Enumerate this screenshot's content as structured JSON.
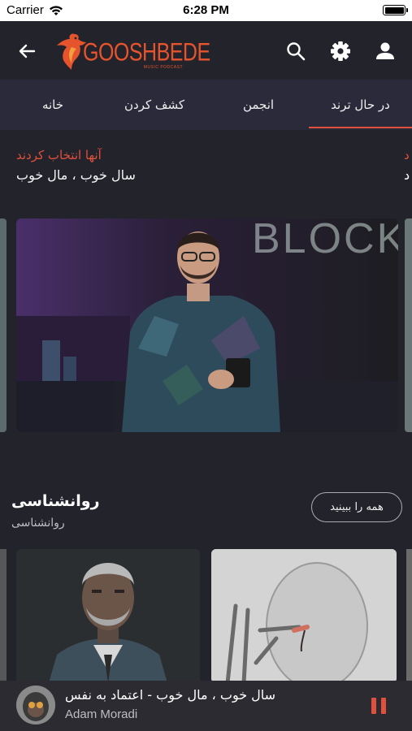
{
  "status": {
    "carrier": "Carrier",
    "time": "6:28 PM"
  },
  "header": {
    "logo": {
      "wordmark": "GOOSHBEDE",
      "tagline": "MUSIC PODCAST"
    },
    "icons": [
      "arrow-left-icon",
      "search-icon",
      "gear-icon",
      "user-icon"
    ]
  },
  "tabs": [
    {
      "label": "در حال ترند",
      "active": true
    },
    {
      "label": "انجمن",
      "active": false
    },
    {
      "label": "کشف کردن",
      "active": false
    },
    {
      "label": "خانه",
      "active": false
    }
  ],
  "featured": {
    "title": "آنها انتخاب کردند",
    "subtitle": "سال خوب ، مال خوب",
    "next_title": "د",
    "next_subtitle": "د"
  },
  "section": {
    "title": "روانشناسی",
    "subtitle": "روانشناسی",
    "see_all": "همه را ببینید"
  },
  "player": {
    "track": "سال خوب ، مال خوب - اعتماد به نفس",
    "artist": "Adam Moradi",
    "accent": "#e0503c"
  },
  "colors": {
    "background": "#23232b",
    "tab_bar": "#2a2a3a",
    "accent": "#e0503c"
  }
}
